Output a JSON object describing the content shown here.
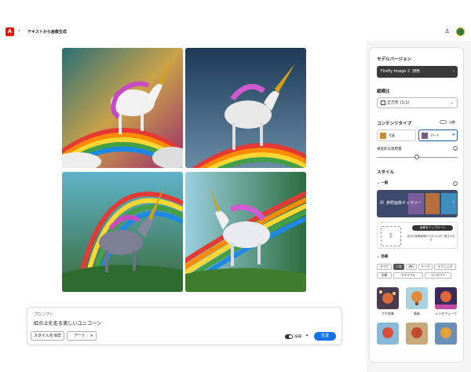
{
  "header": {
    "logo_label": "A",
    "back_label": "‹",
    "title": "テキストから画像生成",
    "help_icon": "♙"
  },
  "prompt": {
    "label": "プロンプト",
    "text": "虹の上を走る美しいユニコーン",
    "clear_style_label": "スタイルを消去",
    "art_chip_label": "アート",
    "art_chip_close": "×",
    "toggle_label": "候補",
    "generate_label": "生成"
  },
  "panel": {
    "model_heading": "モデルバージョン",
    "model_value": "Firefly Image 2",
    "model_badge": "NEW",
    "aspect_heading": "縦横比",
    "aspect_value": "正方形 (1:1)",
    "content_type_heading": "コンテンツタイプ",
    "auto_label": "自動",
    "photo_label": "写真",
    "art_label": "アート",
    "visual_intensity_label": "視覚的な適用量",
    "style_heading": "スタイル",
    "general_label": "一般",
    "gallery_label": "参照画像ギャラリー",
    "upload_button_label": "画像をアップロード",
    "upload_hint": "自分の参照画像のスタイルを一致させます",
    "effects_label": "効果",
    "filter_row1": [
      "すべて",
      "人気",
      "流行",
      "テーマ",
      "テクニック"
    ],
    "filter_row2": [
      "効果",
      "マテリアル",
      "コンセプト"
    ],
    "thumb_labels": [
      "ボケ効果",
      "彫紙",
      "シンセウェーブ"
    ]
  },
  "colors": {
    "accent": "#1473e6",
    "brand": "#eb1000"
  }
}
